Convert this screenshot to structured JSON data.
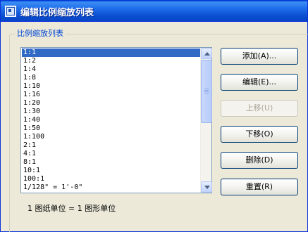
{
  "window": {
    "title": "编辑比例缩放列表"
  },
  "group": {
    "title": "比例缩放列表"
  },
  "scale_list": {
    "items": [
      "1:1",
      "1:2",
      "1:4",
      "1:8",
      "1:10",
      "1:16",
      "1:20",
      "1:30",
      "1:40",
      "1:50",
      "1:100",
      "2:1",
      "4:1",
      "8:1",
      "10:1",
      "100:1",
      "1/128\" = 1'-0\""
    ],
    "selected": "1:1"
  },
  "buttons": {
    "add": "添加(A)...",
    "edit": "编辑(E)...",
    "move_up": "上移(U)",
    "move_down": "下移(O)",
    "delete": "删除(D)",
    "reset": "重置(R)"
  },
  "footer": {
    "units_text": "1 图纸单位 = 1 图形单位"
  },
  "colors": {
    "title_bar": "#0a4fd0",
    "selection": "#316ac5",
    "group_title": "#0046d5"
  }
}
